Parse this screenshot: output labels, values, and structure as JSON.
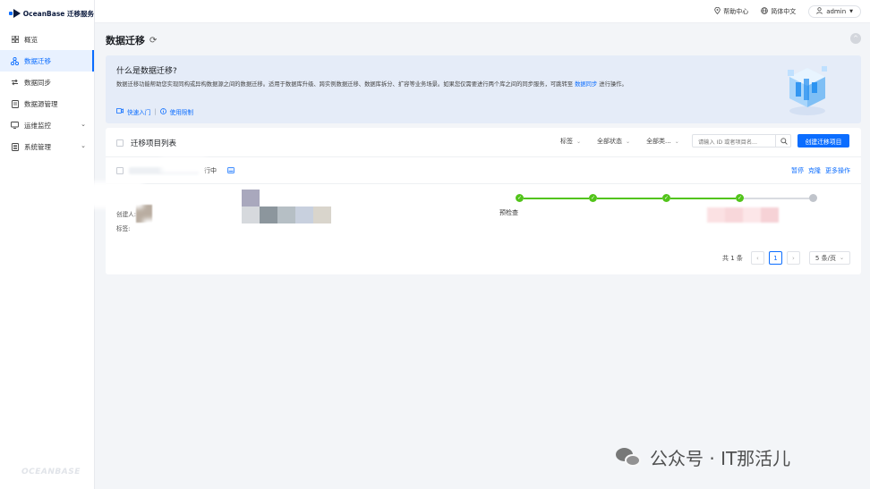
{
  "app": {
    "logo_text": "OceanBase 迁移服务",
    "footer_logo": "OCEANBASE"
  },
  "sidebar": {
    "items": [
      {
        "label": "概览",
        "icon": "grid-icon",
        "active": false,
        "expandable": false
      },
      {
        "label": "数据迁移",
        "icon": "migrate-icon",
        "active": true,
        "expandable": false
      },
      {
        "label": "数据同步",
        "icon": "sync-icon",
        "active": false,
        "expandable": false
      },
      {
        "label": "数据源管理",
        "icon": "datasource-icon",
        "active": false,
        "expandable": false
      },
      {
        "label": "运维监控",
        "icon": "monitor-icon",
        "active": false,
        "expandable": true
      },
      {
        "label": "系统管理",
        "icon": "system-icon",
        "active": false,
        "expandable": true
      }
    ]
  },
  "topbar": {
    "help": "帮助中心",
    "language": "简体中文",
    "user": "admin"
  },
  "page": {
    "title": "数据迁移"
  },
  "intro": {
    "title": "什么是数据迁移?",
    "desc_pre": "数据迁移功能帮助您实现同构或异构数据源之间的数据迁移。适用于数据库升级、跨实例数据迁移、数据库拆分、扩容等业务场景。如果您仅需要进行两个库之间的同步服务，可跳转至",
    "desc_link": "数据同步",
    "desc_post": "进行操作。",
    "quick_start": "快速入门",
    "limits": "使用限制"
  },
  "list": {
    "title": "迁移项目列表",
    "filter_tag": "标签",
    "filter_status": "全部状态",
    "filter_type": "全部类...",
    "search_placeholder": "请输入 ID 或者项目名...",
    "create_button": "创建迁移项目",
    "row": {
      "status": "行中",
      "actions": {
        "pause": "暂停",
        "clone": "克隆",
        "more": "更多操作"
      },
      "creator_label": "创建人:",
      "tag_label": "标签:",
      "step_label": "预检查",
      "steps_done": 4,
      "steps_total": 5
    }
  },
  "pagination": {
    "total": "共 1 条",
    "current": "1",
    "page_size": "5 条/页"
  },
  "watermark": {
    "text": "公众号 · IT那活儿"
  },
  "colors": {
    "accent": "#0b6dff",
    "success": "#52c41a",
    "banner": "#e5ecf8"
  }
}
